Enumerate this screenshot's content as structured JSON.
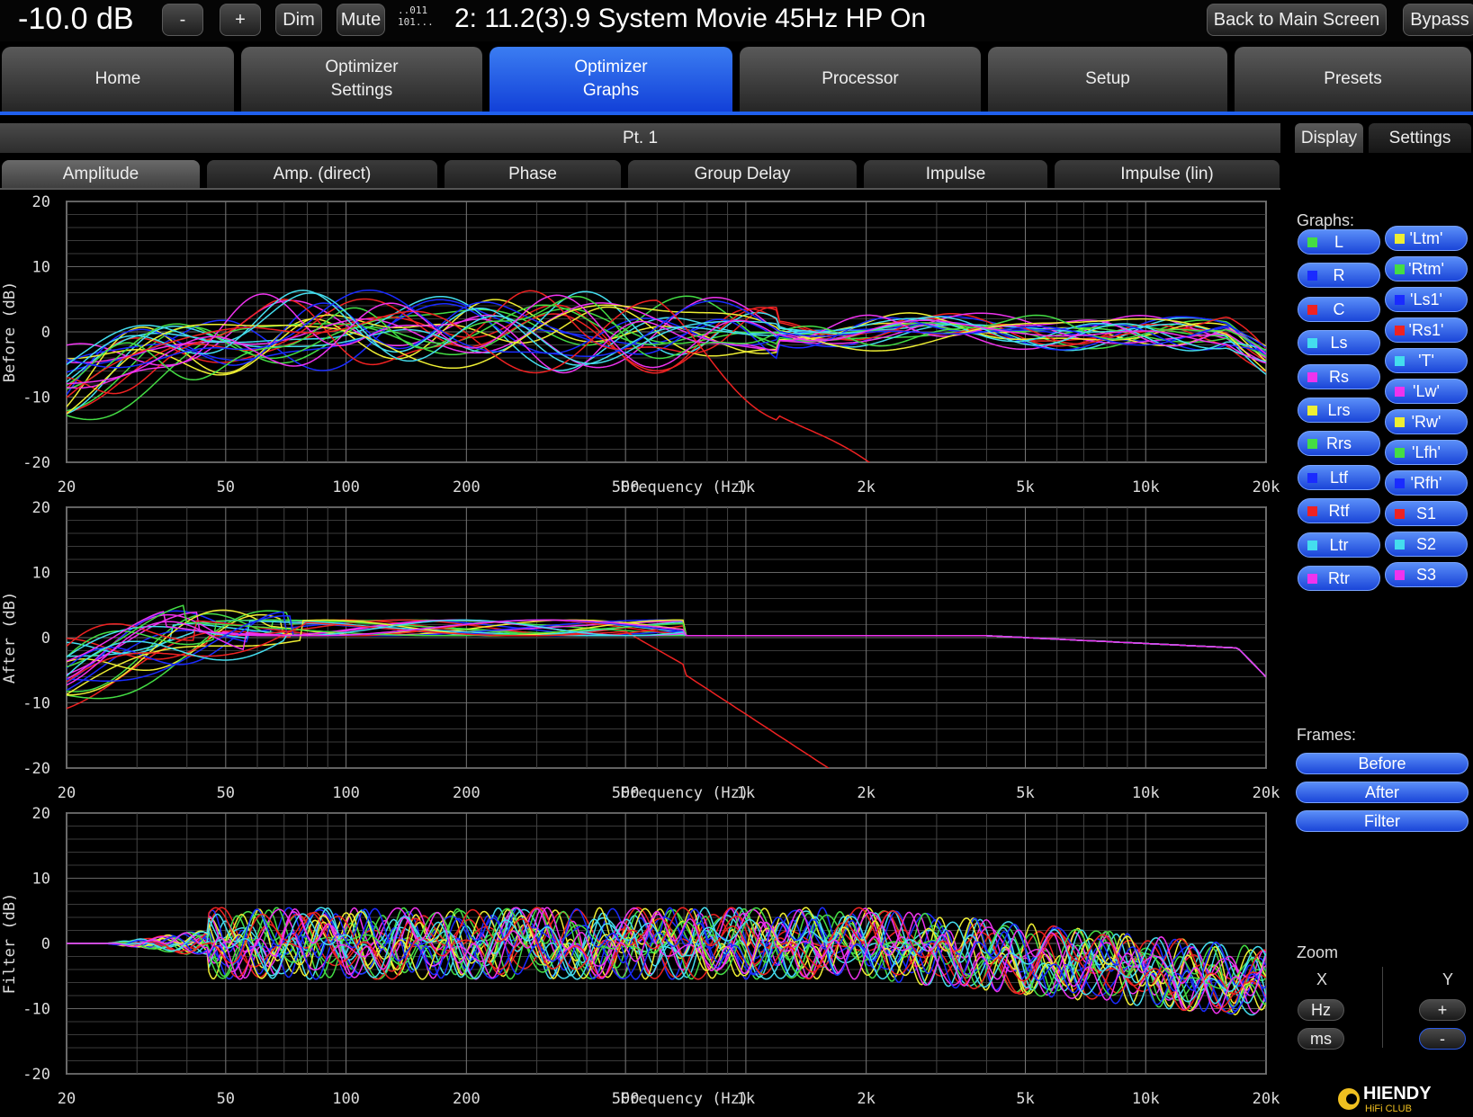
{
  "topbar": {
    "volume": "-10.0 dB",
    "minus": "-",
    "plus": "+",
    "dim": "Dim",
    "mute": "Mute",
    "bits_line1": "..011",
    "bits_line2": "101...",
    "preset": "2: 11.2(3).9 System Movie 45Hz HP On",
    "back": "Back to Main Screen",
    "bypass": "Bypass"
  },
  "main_tabs": [
    {
      "label": "Home"
    },
    {
      "label": "Optimizer",
      "label2": "Settings"
    },
    {
      "label": "Optimizer",
      "label2": "Graphs",
      "active": true
    },
    {
      "label": "Processor"
    },
    {
      "label": "Setup"
    },
    {
      "label": "Presets"
    }
  ],
  "position_label": "Pt. 1",
  "graph_tabs": [
    "Amplitude",
    "Amp. (direct)",
    "Phase",
    "Group Delay",
    "Impulse",
    "Impulse (lin)"
  ],
  "side": {
    "tab_display": "Display",
    "tab_settings": "Settings",
    "graphs_label": "Graphs:",
    "channels_left": [
      {
        "label": "L",
        "color": "#44dd44"
      },
      {
        "label": "R",
        "color": "#1a2bff"
      },
      {
        "label": "C",
        "color": "#ee2222"
      },
      {
        "label": "Ls",
        "color": "#44ddee"
      },
      {
        "label": "Rs",
        "color": "#ee33ee"
      },
      {
        "label": "Lrs",
        "color": "#eeee33"
      },
      {
        "label": "Rrs",
        "color": "#44dd44"
      },
      {
        "label": "Ltf",
        "color": "#1a2bff"
      },
      {
        "label": "Rtf",
        "color": "#ee2222"
      },
      {
        "label": "Ltr",
        "color": "#44ddee"
      },
      {
        "label": "Rtr",
        "color": "#ee33ee"
      }
    ],
    "channels_right": [
      {
        "label": "'Ltm'",
        "color": "#eeee33"
      },
      {
        "label": "'Rtm'",
        "color": "#44dd44"
      },
      {
        "label": "'Ls1'",
        "color": "#1a2bff"
      },
      {
        "label": "'Rs1'",
        "color": "#ee2222"
      },
      {
        "label": "'T'",
        "color": "#44ddee"
      },
      {
        "label": "'Lw'",
        "color": "#ee33ee"
      },
      {
        "label": "'Rw'",
        "color": "#eeee33"
      },
      {
        "label": "'Lfh'",
        "color": "#44dd44"
      },
      {
        "label": "'Rfh'",
        "color": "#1a2bff"
      },
      {
        "label": "S1",
        "color": "#ee2222"
      },
      {
        "label": "S2",
        "color": "#44ddee"
      },
      {
        "label": "S3",
        "color": "#ee33ee"
      }
    ],
    "frames_label": "Frames:",
    "frames": [
      "Before",
      "After",
      "Filter"
    ],
    "zoom_label": "Zoom",
    "zoom_x": "X",
    "zoom_y": "Y",
    "zoom_hz": "Hz",
    "zoom_ms": "ms",
    "zoom_plus": "+",
    "zoom_minus": "-"
  },
  "logo": {
    "line1": "HIENDY",
    "line2": "HiFi CLUB"
  },
  "chart_data": [
    {
      "type": "line",
      "ylabel": "Before (dB)",
      "xlabel": "Frequency (Hz)",
      "xscale": "log",
      "xlim": [
        20,
        20000
      ],
      "ylim": [
        -20,
        20
      ],
      "x_ticks": [
        {
          "v": 20,
          "t": "20"
        },
        {
          "v": 50,
          "t": "50"
        },
        {
          "v": 100,
          "t": "100"
        },
        {
          "v": 200,
          "t": "200"
        },
        {
          "v": 500,
          "t": "500"
        },
        {
          "v": 1000,
          "t": "1k"
        },
        {
          "v": 2000,
          "t": "2k"
        },
        {
          "v": 5000,
          "t": "5k"
        },
        {
          "v": 10000,
          "t": "10k"
        },
        {
          "v": 20000,
          "t": "20k"
        }
      ],
      "y_ticks": [
        20,
        10,
        0,
        -10,
        -20
      ],
      "grid": true,
      "series_count": 23,
      "shape": "before"
    },
    {
      "type": "line",
      "ylabel": "After (dB)",
      "xlabel": "Frequency (Hz)",
      "xscale": "log",
      "xlim": [
        20,
        20000
      ],
      "ylim": [
        -20,
        20
      ],
      "x_ticks": [
        {
          "v": 20,
          "t": "20"
        },
        {
          "v": 50,
          "t": "50"
        },
        {
          "v": 100,
          "t": "100"
        },
        {
          "v": 200,
          "t": "200"
        },
        {
          "v": 500,
          "t": "500"
        },
        {
          "v": 1000,
          "t": "1k"
        },
        {
          "v": 2000,
          "t": "2k"
        },
        {
          "v": 5000,
          "t": "5k"
        },
        {
          "v": 10000,
          "t": "10k"
        },
        {
          "v": 20000,
          "t": "20k"
        }
      ],
      "y_ticks": [
        20,
        10,
        0,
        -10,
        -20
      ],
      "grid": true,
      "series_count": 23,
      "shape": "after"
    },
    {
      "type": "line",
      "ylabel": "Filter (dB)",
      "xlabel": "Frequency (Hz)",
      "xscale": "log",
      "xlim": [
        20,
        20000
      ],
      "ylim": [
        -20,
        20
      ],
      "x_ticks": [
        {
          "v": 20,
          "t": "20"
        },
        {
          "v": 50,
          "t": "50"
        },
        {
          "v": 100,
          "t": "100"
        },
        {
          "v": 200,
          "t": "200"
        },
        {
          "v": 500,
          "t": "500"
        },
        {
          "v": 1000,
          "t": "1k"
        },
        {
          "v": 2000,
          "t": "2k"
        },
        {
          "v": 5000,
          "t": "5k"
        },
        {
          "v": 10000,
          "t": "10k"
        },
        {
          "v": 20000,
          "t": "20k"
        }
      ],
      "y_ticks": [
        20,
        10,
        0,
        -10,
        -20
      ],
      "grid": true,
      "series_count": 23,
      "shape": "filter"
    }
  ]
}
